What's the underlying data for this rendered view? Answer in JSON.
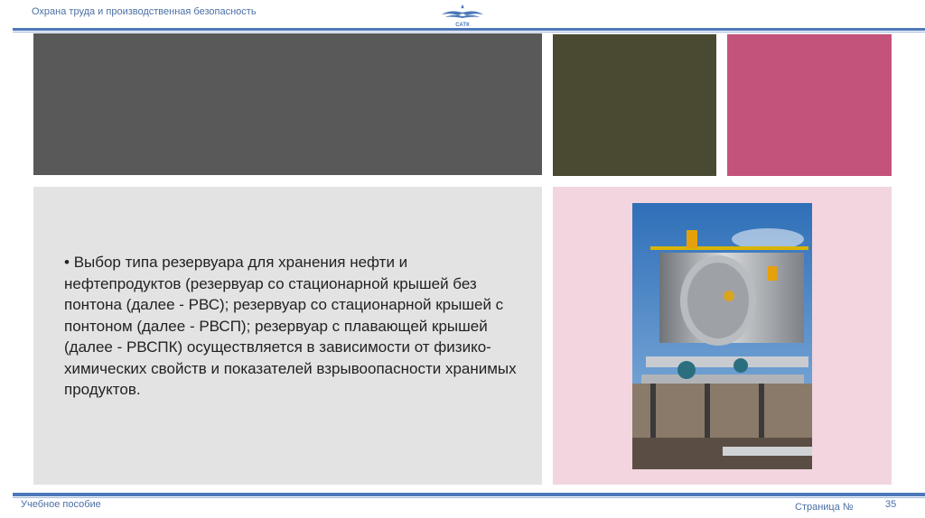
{
  "header": {
    "title": "Охрана труда и производственная безопасность",
    "logo_text": "САТК"
  },
  "content": {
    "bullet": "•",
    "paragraph": "Выбор типа резервуара для хранения нефти и нефтепродуктов (резервуар со стационарной крышей без понтона (далее - РВС); резервуар со стационарной крышей с понтоном (далее - РВСП); резервуар с плавающей крышей (далее - РВСПК) осуществляется в зависимости от физико-химических свойств и показателей взрывоопасности хранимых продуктов."
  },
  "footer": {
    "left": "Учебное пособие",
    "page_label": "Страница №",
    "page_number": "35"
  },
  "colors": {
    "accent_blue": "#4c78b8",
    "block_gray": "#595959",
    "block_olive": "#4a4a33",
    "block_rose": "#c4537c",
    "text_panel": "#e3e3e3",
    "photo_panel": "#f2d5df"
  },
  "images": {
    "photo": "oil-storage-tank-photo",
    "logo": "satk-logo"
  }
}
